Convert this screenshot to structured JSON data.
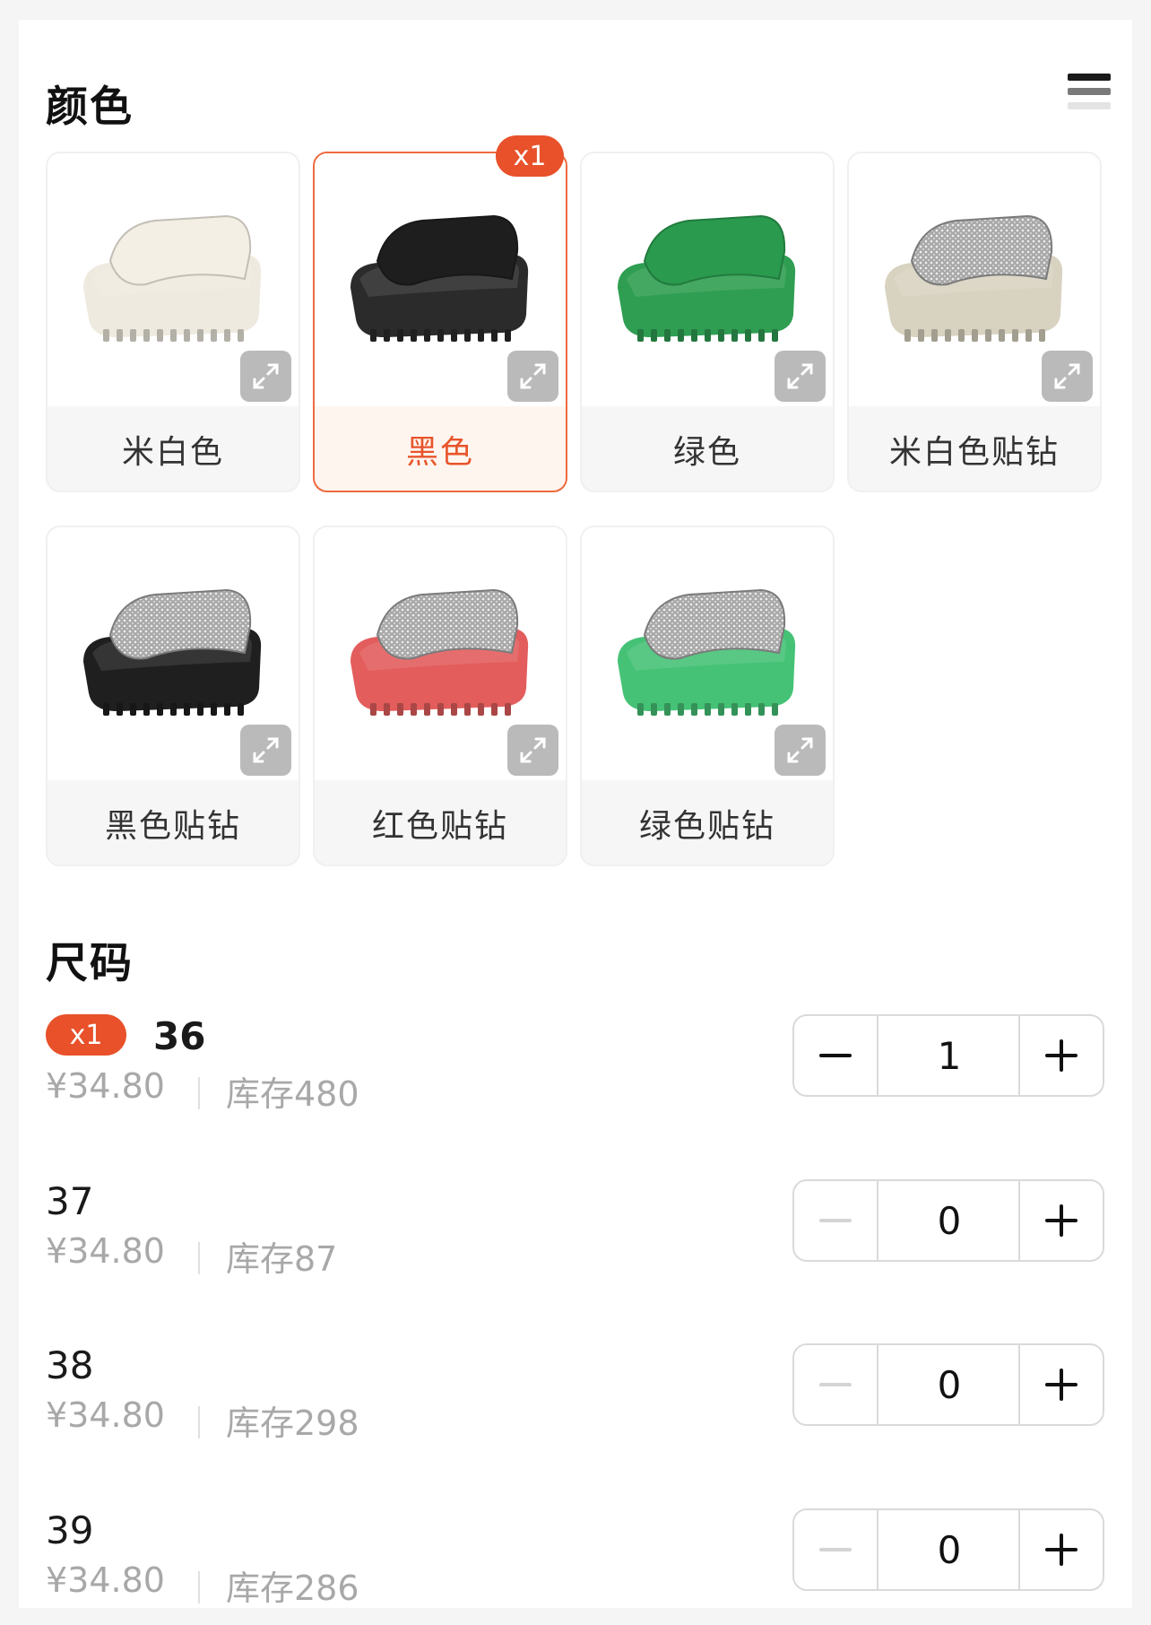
{
  "color_section": {
    "title": "颜色"
  },
  "colors": [
    {
      "label": "米白色",
      "selected": false,
      "badge": "",
      "image": "beige-slide-sandal",
      "body": "#efeadf",
      "strap": "#f4efe4",
      "rhinestone": false
    },
    {
      "label": "黑色",
      "selected": true,
      "badge": "x1",
      "image": "black-slide-sandal",
      "body": "#2b2b2b",
      "strap": "#1e1e1e",
      "rhinestone": false
    },
    {
      "label": "绿色",
      "selected": false,
      "badge": "",
      "image": "green-slide-sandal",
      "body": "#2f9e52",
      "strap": "#2a9a4e",
      "rhinestone": false
    },
    {
      "label": "米白色贴钻",
      "selected": false,
      "badge": "",
      "image": "beige-rhinestone-slide",
      "body": "#d8d2c0",
      "strap": "#b9b9b9",
      "rhinestone": true
    },
    {
      "label": "黑色贴钻",
      "selected": false,
      "badge": "",
      "image": "black-rhinestone-slide",
      "body": "#1f1f1f",
      "strap": "#b9b9b9",
      "rhinestone": true
    },
    {
      "label": "红色贴钻",
      "selected": false,
      "badge": "",
      "image": "red-rhinestone-slide",
      "body": "#e35d5d",
      "strap": "#bdbdbd",
      "rhinestone": true
    },
    {
      "label": "绿色贴钻",
      "selected": false,
      "badge": "",
      "image": "green-rhinestone-slide",
      "body": "#45c276",
      "strap": "#b9b9b9",
      "rhinestone": true
    }
  ],
  "size_section": {
    "title": "尺码"
  },
  "sizes": [
    {
      "size": "36",
      "price": "¥34.80",
      "stock": "库存480",
      "qty": "1",
      "badge": "x1",
      "active": true
    },
    {
      "size": "37",
      "price": "¥34.80",
      "stock": "库存87",
      "qty": "0",
      "badge": "",
      "active": false
    },
    {
      "size": "38",
      "price": "¥34.80",
      "stock": "库存298",
      "qty": "0",
      "badge": "",
      "active": false
    },
    {
      "size": "39",
      "price": "¥34.80",
      "stock": "库存286",
      "qty": "0",
      "badge": "",
      "active": false
    }
  ],
  "icons": {
    "view_toggle": "list-view-icon",
    "expand": "expand-icon",
    "minus": "minus-icon",
    "plus": "plus-icon"
  },
  "theme": {
    "accent": "#e8512a",
    "selected_border": "#ee6a3f",
    "muted_text": "#a8a8a8"
  }
}
